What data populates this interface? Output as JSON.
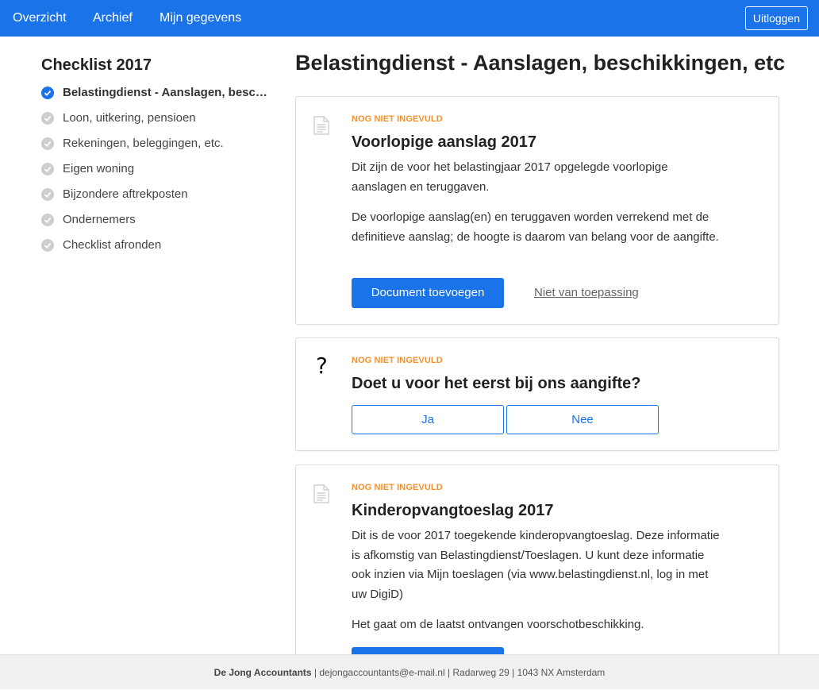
{
  "topnav": {
    "items": [
      "Overzicht",
      "Archief",
      "Mijn gegevens"
    ],
    "logout_label": "Uitloggen"
  },
  "sidebar": {
    "title": "Checklist 2017",
    "items": [
      {
        "label": "Belastingdienst - Aanslagen, beschikkingen, etc",
        "active": true
      },
      {
        "label": "Loon, uitkering, pensioen",
        "active": false
      },
      {
        "label": "Rekeningen, beleggingen, etc.",
        "active": false
      },
      {
        "label": "Eigen woning",
        "active": false
      },
      {
        "label": "Bijzondere aftrekposten",
        "active": false
      },
      {
        "label": "Ondernemers",
        "active": false
      },
      {
        "label": "Checklist afronden",
        "active": false
      }
    ]
  },
  "main": {
    "title": "Belastingdienst - Aanslagen, beschikkingen, etc",
    "cards": [
      {
        "status": "NOG NIET INGEVULD",
        "title": "Voorlopige aanslag 2017",
        "paragraphs": [
          "Dit zijn de voor het belastingjaar 2017 opgelegde voorlopige aanslagen en teruggaven.",
          "De voorlopige aanslag(en) en teruggaven worden verrekend met de definitieve aanslag; de hoogte is daarom van belang voor de aangifte."
        ],
        "primary_button": "Document toevoegen",
        "secondary_link": "Niet van toepassing"
      },
      {
        "status": "NOG NIET INGEVULD",
        "title": "Doet u voor het eerst bij ons aangifte?",
        "icon_glyph": "?",
        "options": [
          "Ja",
          "Nee"
        ]
      },
      {
        "status": "NOG NIET INGEVULD",
        "title": "Kinderopvangtoeslag 2017",
        "paragraphs": [
          "Dit is de voor 2017 toegekende kinderopvangtoeslag. Deze informatie is afkomstig van Belastingdienst/Toeslagen. U kunt deze informatie ook inzien via Mijn toeslagen (via www.belastingdienst.nl, log in met uw DigiD)",
          "Het gaat om de laatst ontvangen voorschotbeschikking."
        ]
      }
    ]
  },
  "footer": {
    "company": "De Jong Accountants",
    "details": " | dejongaccountants@e-mail.nl | Radarweg 29 | 1043 NX Amsterdam"
  },
  "colors": {
    "primary": "#1a73e8",
    "status_orange": "#f0922b",
    "check_inactive": "#cfcfcf"
  }
}
